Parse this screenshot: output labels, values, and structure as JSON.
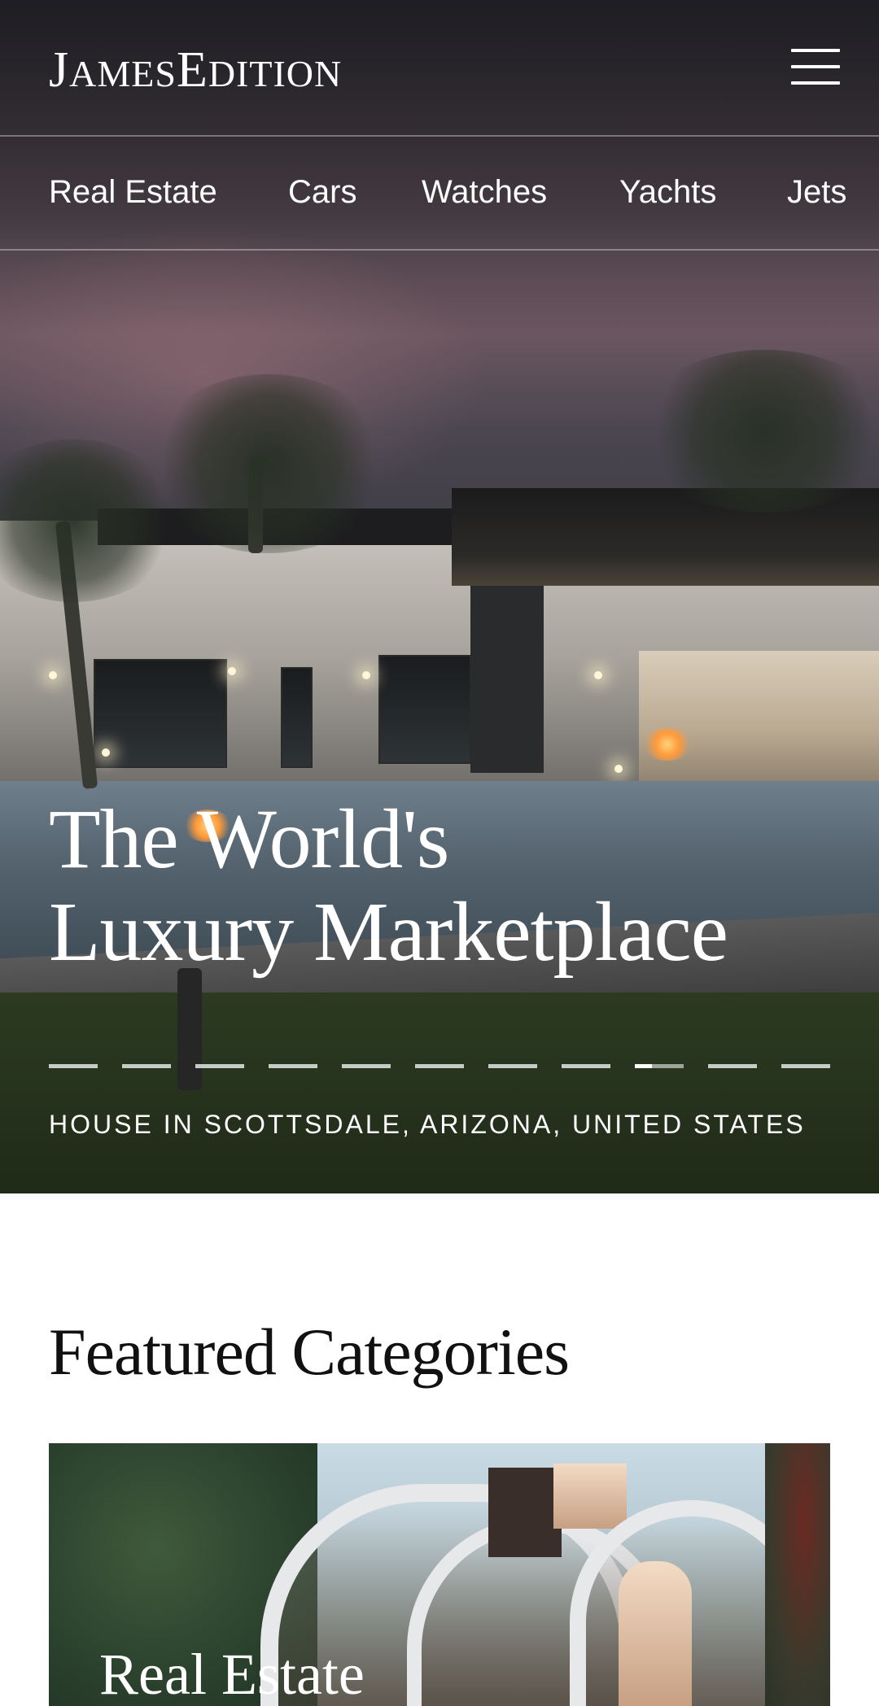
{
  "header": {
    "logo_text": "JamesEdition",
    "menu_icon": "hamburger-icon"
  },
  "nav": {
    "items": [
      {
        "label": "Real Estate"
      },
      {
        "label": "Cars"
      },
      {
        "label": "Watches"
      },
      {
        "label": "Yachts"
      },
      {
        "label": "Jets"
      }
    ]
  },
  "hero": {
    "title_line1": "The World's",
    "title_line2": "Luxury Marketplace",
    "slides_total": 11,
    "active_slide": 9,
    "active_slide_progress": 0.35,
    "caption": "HOUSE IN SCOTTSDALE, ARIZONA, UNITED STATES"
  },
  "featured": {
    "title": "Featured Categories",
    "cards": [
      {
        "label": "Real Estate"
      }
    ]
  }
}
